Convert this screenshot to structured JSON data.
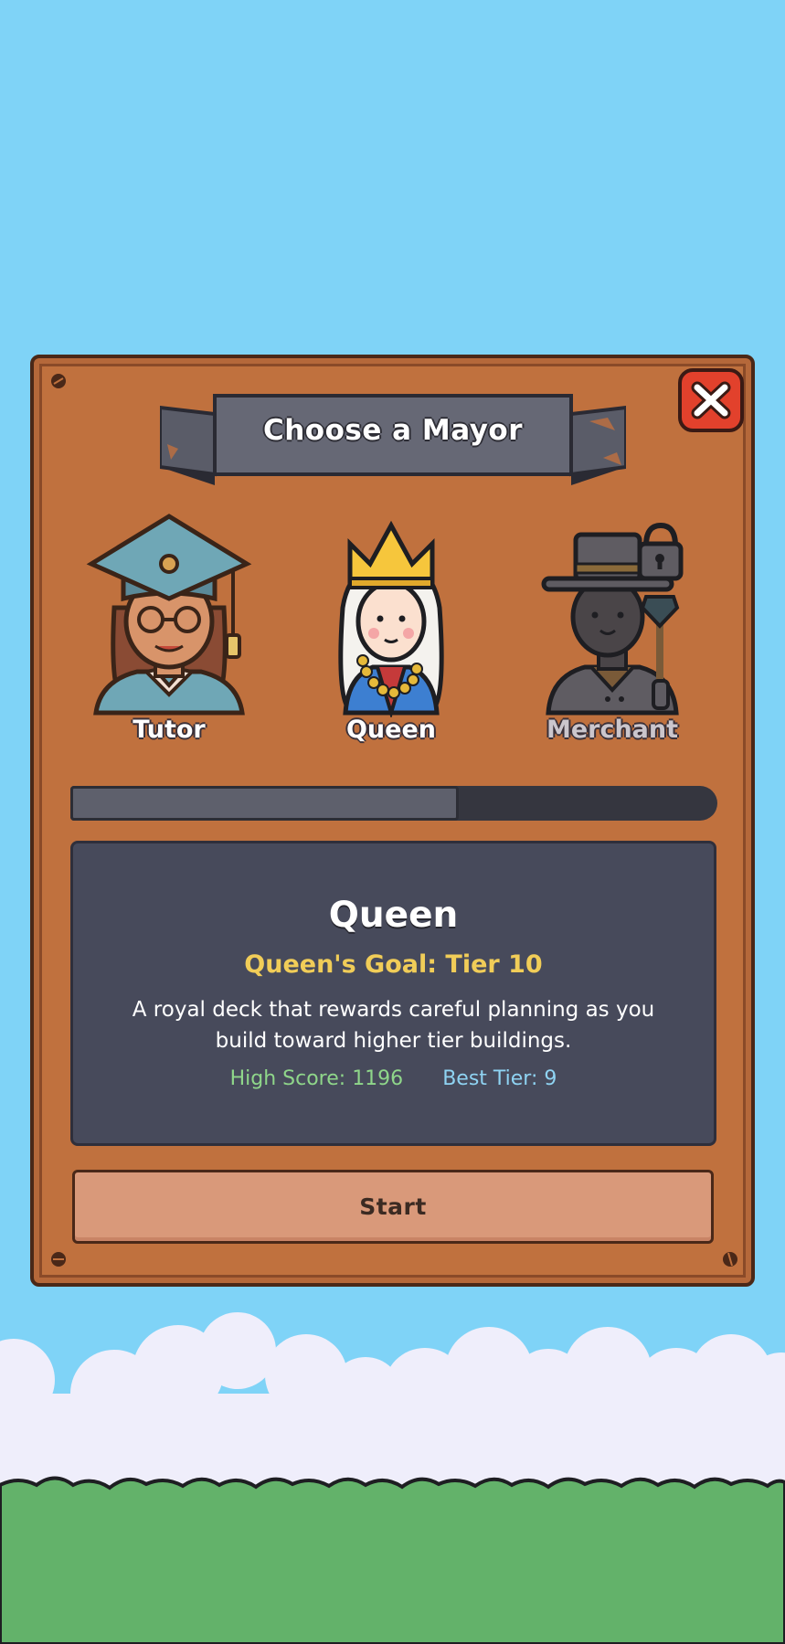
{
  "dialog": {
    "title": "Choose a Mayor",
    "close_icon": "close-x-icon"
  },
  "mayors": [
    {
      "label": "Tutor",
      "icon": "tutor-graduate-avatar",
      "locked": false
    },
    {
      "label": "Queen",
      "icon": "queen-crown-avatar",
      "locked": false,
      "selected": true
    },
    {
      "label": "Merchant",
      "icon": "merchant-hat-avatar",
      "locked": true,
      "lock_icon": "padlock-icon"
    }
  ],
  "progress": {
    "fraction": 0.6
  },
  "details": {
    "name": "Queen",
    "goal": "Queen's Goal: Tier 10",
    "description": "A royal deck that rewards careful planning as you build toward higher tier buildings.",
    "high_score": "High Score: 1196",
    "best_tier": "Best Tier: 9"
  },
  "start_label": "Start",
  "colors": {
    "sky": "#7fd3f7",
    "panel": "#c0713e",
    "info_box": "#474a5b",
    "goal": "#f1cd58",
    "high_score": "#8fd68a",
    "best_tier": "#8fd3f2",
    "start_button": "#d9997a",
    "close_button": "#e2412c",
    "grass": "#63b26a"
  }
}
